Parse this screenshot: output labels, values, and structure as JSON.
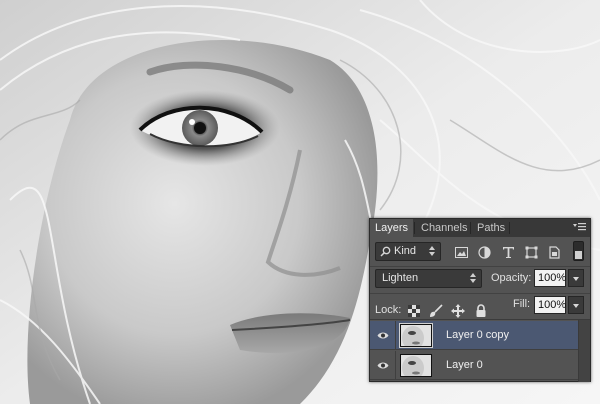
{
  "panel": {
    "tabs": [
      {
        "label": "Layers",
        "active": true
      },
      {
        "label": "Channels",
        "active": false
      },
      {
        "label": "Paths",
        "active": false
      }
    ],
    "menu_icon": "panel-menu-icon",
    "filter": {
      "label": "Kind",
      "icons": [
        "image-filter-icon",
        "adjustment-filter-icon",
        "type-filter-icon",
        "shape-filter-icon",
        "smart-object-filter-icon"
      ]
    },
    "blend_mode": "Lighten",
    "opacity_label": "Opacity:",
    "opacity_value": "100%",
    "lock_label": "Lock:",
    "lock_icons": [
      "lock-transparent-icon",
      "lock-image-icon",
      "lock-position-icon",
      "lock-all-icon"
    ],
    "fill_label": "Fill:",
    "fill_value": "100%",
    "layers": [
      {
        "name": "Layer 0 copy",
        "visible": true,
        "selected": true
      },
      {
        "name": "Layer 0",
        "visible": true,
        "selected": false
      }
    ]
  },
  "colors": {
    "panel_bg": "#535353",
    "tab_bar": "#383838",
    "selected_row": "#4b5872"
  }
}
